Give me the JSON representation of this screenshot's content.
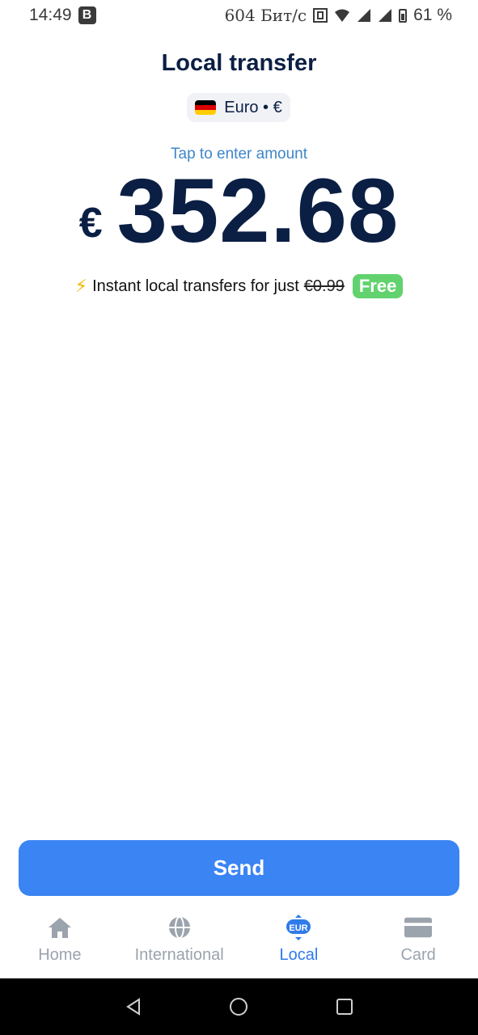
{
  "status_bar": {
    "time": "14:49",
    "badge": "B",
    "speed": "604 Бит/с",
    "battery": "61 %"
  },
  "header": {
    "title": "Local transfer",
    "currency_chip": "Euro • €"
  },
  "amount": {
    "hint": "Tap to enter amount",
    "currency_symbol": "€",
    "value": "352.68"
  },
  "promo": {
    "text": "Instant local transfers for just",
    "old_price": "€0.99",
    "badge": "Free"
  },
  "send_label": "Send",
  "bottom_nav": {
    "items": [
      {
        "label": "Home",
        "icon": "home-icon"
      },
      {
        "label": "International",
        "icon": "globe-icon"
      },
      {
        "label": "Local",
        "icon": "eur-transfer-icon",
        "icon_text": "EUR"
      },
      {
        "label": "Card",
        "icon": "card-icon"
      }
    ],
    "active": "Local"
  },
  "colors": {
    "primary": "#3a84f4",
    "text_dark": "#0b1f44",
    "hint": "#3f86c9",
    "free_badge": "#62d26f",
    "nav_inactive": "#9ba3ad",
    "nav_active": "#2f7be8"
  }
}
